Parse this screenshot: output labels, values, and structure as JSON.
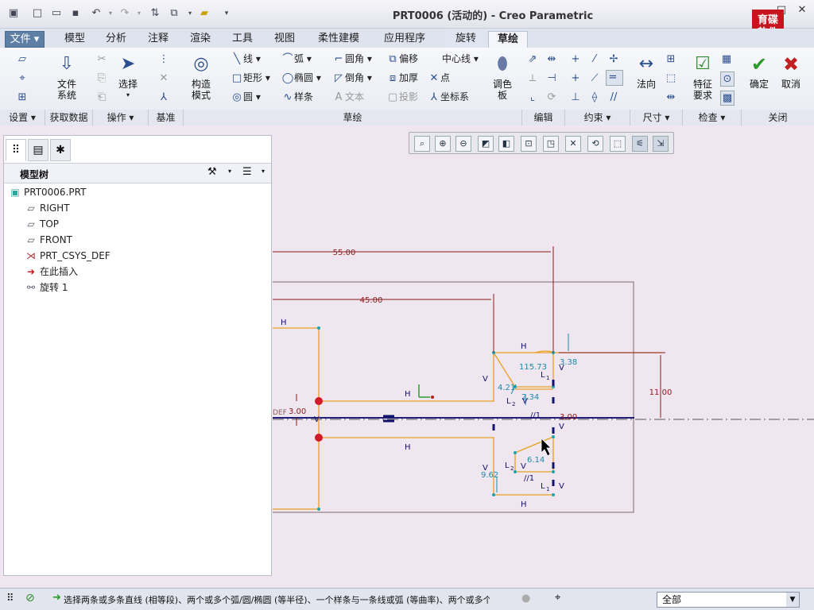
{
  "window": {
    "title": "PRT0006 (活动的) - Creo Parametric",
    "logo_text": [
      "育碟",
      "软件"
    ]
  },
  "tabs": [
    {
      "label": "文件",
      "name": "tab-file"
    },
    {
      "label": "模型",
      "name": "tab-model"
    },
    {
      "label": "分析",
      "name": "tab-analysis"
    },
    {
      "label": "注释",
      "name": "tab-annotate"
    },
    {
      "label": "渲染",
      "name": "tab-render"
    },
    {
      "label": "工具",
      "name": "tab-tools"
    },
    {
      "label": "视图",
      "name": "tab-view"
    },
    {
      "label": "柔性建模",
      "name": "tab-flexible-modeling"
    },
    {
      "label": "应用程序",
      "name": "tab-applications"
    },
    {
      "label": "旋转",
      "name": "tab-revolve"
    },
    {
      "label": "草绘",
      "name": "tab-sketch"
    }
  ],
  "ribbon": {
    "file_system": "文件\n系统",
    "select": "选择",
    "construction_mode": "构造\n模式",
    "line": "线",
    "arc": "弧",
    "fillet": "圆角",
    "offset": "偏移",
    "centerline": "中心线",
    "rectangle": "矩形",
    "ellipse": "椭圆",
    "chamfer": "倒角",
    "thicken": "加厚",
    "point": "点",
    "circle": "圆",
    "spline": "样条",
    "text": "文本",
    "project": "投影",
    "coordsys": "坐标系",
    "palette": "调色\n板",
    "normal": "法向",
    "feature_req": "特征\n要求",
    "ok": "确定",
    "cancel": "取消"
  },
  "groups": {
    "setup": "设置",
    "get_data": "获取数据",
    "operations": "操作",
    "datum": "基准",
    "sketching": "草绘",
    "editing": "编辑",
    "constrain": "约束",
    "dimension": "尺寸",
    "inspect": "检查",
    "close": "关闭"
  },
  "panel": {
    "header": "模型树",
    "items": [
      {
        "label": "PRT0006.PRT",
        "icon": "part-icon"
      },
      {
        "label": "RIGHT",
        "icon": "datum-plane-icon"
      },
      {
        "label": "TOP",
        "icon": "datum-plane-icon"
      },
      {
        "label": "FRONT",
        "icon": "datum-plane-icon"
      },
      {
        "label": "PRT_CSYS_DEF",
        "icon": "csys-icon"
      },
      {
        "label": "在此插入",
        "icon": "insert-arrow-icon"
      },
      {
        "label": "旋转 1",
        "icon": "revolve-icon"
      }
    ]
  },
  "sketch": {
    "dims": {
      "d55": "55.00",
      "d45": "45.00",
      "d11": "11.00",
      "d3_left": "3.00",
      "d3_right": "3.00",
      "d338": "3.38",
      "d11573": "115.73",
      "d421": "4.21",
      "d234": "2.34",
      "d614": "6.14",
      "d962": "9.62",
      "def": "DEF"
    },
    "constraints": {
      "H": "H",
      "V": "V",
      "L1": "L",
      "L2": "L",
      "sub1": "1",
      "sub2": "2",
      "par": "//1"
    }
  },
  "status": {
    "message": "选择两条或多条直线 (相等段)、两个或多个弧/圆/椭圆 (等半径)、一个样条与一条线或弧 (等曲率)、两个或多个",
    "filter": "全部"
  },
  "colors": {
    "sketch_line": "#e8a020",
    "dimension": "#8b1a1a",
    "weak_dim": "#1c8aa8",
    "constraint": "#12126e",
    "point": "#d01a2a"
  }
}
